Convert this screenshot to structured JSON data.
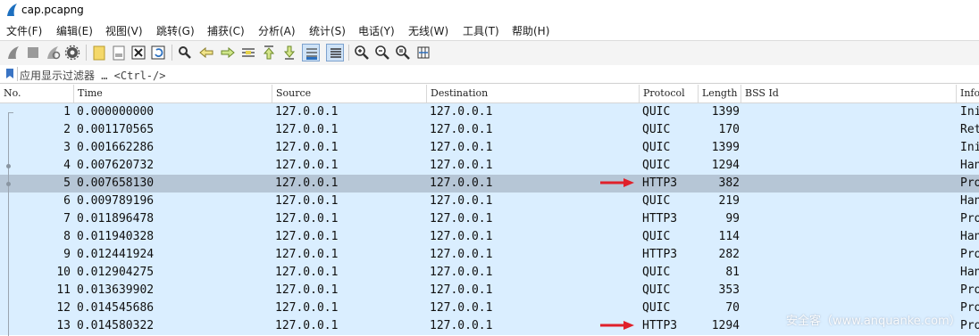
{
  "window": {
    "title": "cap.pcapng"
  },
  "menu": [
    "文件(F)",
    "编辑(E)",
    "视图(V)",
    "跳转(G)",
    "捕获(C)",
    "分析(A)",
    "统计(S)",
    "电话(Y)",
    "无线(W)",
    "工具(T)",
    "帮助(H)"
  ],
  "toolbar": {
    "icons": [
      "shark-start-icon",
      "stop-icon",
      "restart-icon",
      "options-gear-icon",
      "open-file-icon",
      "save-file-icon",
      "close-file-icon",
      "reload-icon",
      "find-icon",
      "go-back-icon",
      "go-forward-icon",
      "go-to-packet-icon",
      "first-packet-icon",
      "last-packet-icon",
      "autoscroll-icon",
      "colorize-icon",
      "zoom-in-icon",
      "zoom-out-icon",
      "zoom-normal-icon",
      "resize-columns-icon"
    ]
  },
  "filter": {
    "placeholder": "应用显示过滤器 … <Ctrl-/>"
  },
  "columns": {
    "no": "No.",
    "time": "Time",
    "source": "Source",
    "destination": "Destination",
    "protocol": "Protocol",
    "length": "Length",
    "bssid": "BSS Id",
    "info": "Info"
  },
  "packets": [
    {
      "no": "1",
      "time": "0.000000000",
      "source": "127.0.0.1",
      "destination": "127.0.0.1",
      "protocol": "QUIC",
      "length": "1399",
      "bssid": "",
      "info": "Ini"
    },
    {
      "no": "2",
      "time": "0.001170565",
      "source": "127.0.0.1",
      "destination": "127.0.0.1",
      "protocol": "QUIC",
      "length": "170",
      "bssid": "",
      "info": "Ret"
    },
    {
      "no": "3",
      "time": "0.001662286",
      "source": "127.0.0.1",
      "destination": "127.0.0.1",
      "protocol": "QUIC",
      "length": "1399",
      "bssid": "",
      "info": "Ini"
    },
    {
      "no": "4",
      "time": "0.007620732",
      "source": "127.0.0.1",
      "destination": "127.0.0.1",
      "protocol": "QUIC",
      "length": "1294",
      "bssid": "",
      "info": "Han"
    },
    {
      "no": "5",
      "time": "0.007658130",
      "source": "127.0.0.1",
      "destination": "127.0.0.1",
      "protocol": "HTTP3",
      "length": "382",
      "bssid": "",
      "info": "Pro"
    },
    {
      "no": "6",
      "time": "0.009789196",
      "source": "127.0.0.1",
      "destination": "127.0.0.1",
      "protocol": "QUIC",
      "length": "219",
      "bssid": "",
      "info": "Han"
    },
    {
      "no": "7",
      "time": "0.011896478",
      "source": "127.0.0.1",
      "destination": "127.0.0.1",
      "protocol": "HTTP3",
      "length": "99",
      "bssid": "",
      "info": "Pro"
    },
    {
      "no": "8",
      "time": "0.011940328",
      "source": "127.0.0.1",
      "destination": "127.0.0.1",
      "protocol": "QUIC",
      "length": "114",
      "bssid": "",
      "info": "Han"
    },
    {
      "no": "9",
      "time": "0.012441924",
      "source": "127.0.0.1",
      "destination": "127.0.0.1",
      "protocol": "HTTP3",
      "length": "282",
      "bssid": "",
      "info": "Pro"
    },
    {
      "no": "10",
      "time": "0.012904275",
      "source": "127.0.0.1",
      "destination": "127.0.0.1",
      "protocol": "QUIC",
      "length": "81",
      "bssid": "",
      "info": "Han"
    },
    {
      "no": "11",
      "time": "0.013639902",
      "source": "127.0.0.1",
      "destination": "127.0.0.1",
      "protocol": "QUIC",
      "length": "353",
      "bssid": "",
      "info": "Pro"
    },
    {
      "no": "12",
      "time": "0.014545686",
      "source": "127.0.0.1",
      "destination": "127.0.0.1",
      "protocol": "QUIC",
      "length": "70",
      "bssid": "",
      "info": "Pro"
    },
    {
      "no": "13",
      "time": "0.014580322",
      "source": "127.0.0.1",
      "destination": "127.0.0.1",
      "protocol": "HTTP3",
      "length": "1294",
      "bssid": "",
      "info": "Pro"
    }
  ],
  "selected_row": 5,
  "annotations": {
    "arrow_rows": [
      5,
      13
    ],
    "arrow_color": "#e0202a"
  },
  "watermark": "安全客（www.anquanke.com）",
  "colors": {
    "row_bg": "#daeeff",
    "selected_bg": "#b6c6d6",
    "accent": "#3a74c4"
  }
}
